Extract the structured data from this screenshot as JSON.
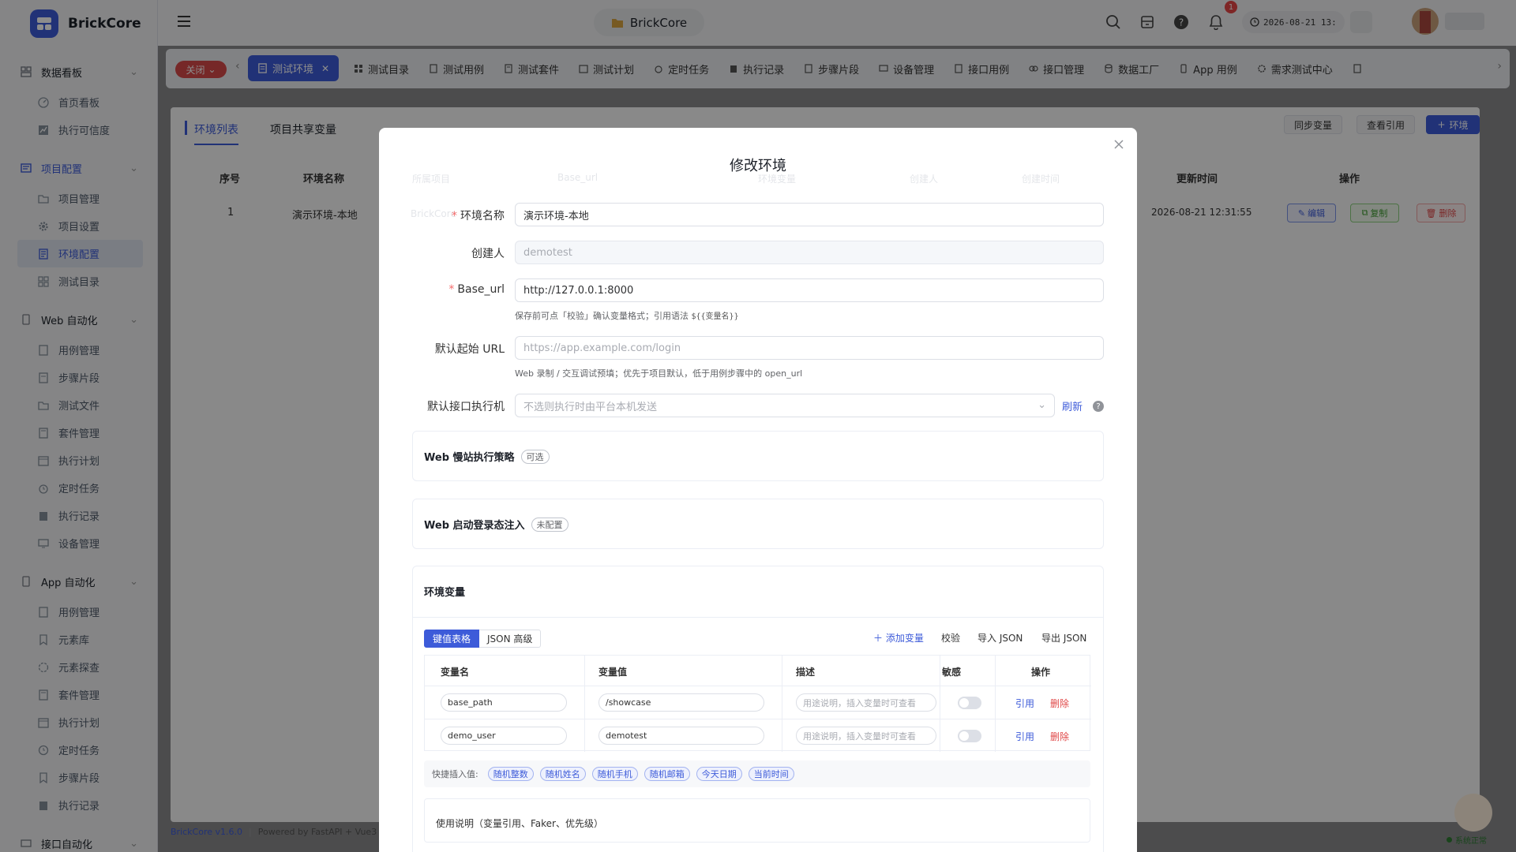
{
  "brand": {
    "name": "BrickCore"
  },
  "sidebar": {
    "groups": [
      {
        "label": "数据看板",
        "items": [
          "首页看板",
          "执行可信度"
        ]
      },
      {
        "label": "项目配置",
        "items": [
          "项目管理",
          "项目设置",
          "环境配置",
          "测试目录"
        ]
      },
      {
        "label": "Web 自动化",
        "items": [
          "用例管理",
          "步骤片段",
          "测试文件",
          "套件管理",
          "执行计划",
          "定时任务",
          "执行记录",
          "设备管理"
        ]
      },
      {
        "label": "App 自动化",
        "items": [
          "用例管理",
          "元素库",
          "元素探查",
          "套件管理",
          "执行计划",
          "定时任务",
          "步骤片段",
          "执行记录"
        ]
      },
      {
        "label": "接口自动化",
        "items": []
      }
    ],
    "active_item": "环境配置"
  },
  "header": {
    "project": "BrickCore",
    "notification_count": "1",
    "datetime": "2026-08-21 13:"
  },
  "tabbar": {
    "close_label": "关闭",
    "active_tab": "测试环境",
    "tabs": [
      "测试目录",
      "测试用例",
      "测试套件",
      "测试计划",
      "定时任务",
      "执行记录",
      "步骤片段",
      "设备管理",
      "接口用例",
      "接口管理",
      "数据工厂",
      "App 用例",
      "需求测试中心"
    ]
  },
  "page": {
    "sub_tabs": [
      "环境列表",
      "项目共享变量"
    ],
    "buttons": {
      "sync": "同步变量",
      "refs": "查看引用",
      "add": "环境"
    },
    "table": {
      "headers": {
        "index": "序号",
        "name": "环境名称",
        "updated": "更新时间",
        "actions": "操作"
      },
      "ghost_headers": [
        "所属项目",
        "Base_url",
        "环境变量",
        "创建人",
        "创建时间"
      ],
      "row": {
        "index": "1",
        "name": "演示环境-本地",
        "updated": "2026-08-21 12:31:55",
        "edit": "编辑",
        "copy": "复制",
        "delete": "删除"
      }
    }
  },
  "footer": {
    "version": "BrickCore v1.6.0",
    "powered": "Powered by FastAPI + Vue3",
    "status": "系统正常"
  },
  "modal": {
    "title": "修改环境",
    "ghost_left": "BrickCore",
    "fields": {
      "name": {
        "label": "环境名称",
        "value": "演示环境-本地"
      },
      "creator": {
        "label": "创建人",
        "value": "demotest"
      },
      "base_url": {
        "label": "Base_url",
        "value": "http://127.0.0.1:8000",
        "hint": "保存前可点「校验」确认变量格式；引用语法",
        "hint_code": "${{变量名}}"
      },
      "start_url": {
        "label": "默认起始 URL",
        "placeholder": "https://app.example.com/login",
        "hint": "Web 录制 / 交互调试预填；优先于项目默认，低于用例步骤中的 open_url"
      },
      "executor": {
        "label": "默认接口执行机",
        "placeholder": "不选则执行时由平台本机发送",
        "refresh": "刷新"
      }
    },
    "cards": {
      "slow_site": {
        "title": "Web 慢站执行策略",
        "tag": "可选"
      },
      "login_inject": {
        "title": "Web 启动登录态注入",
        "tag": "未配置"
      },
      "env_vars": {
        "title": "环境变量"
      }
    },
    "vars": {
      "view_tabs": [
        "键值表格",
        "JSON 高级"
      ],
      "actions": {
        "add": "添加变量",
        "validate": "校验",
        "import": "导入 JSON",
        "export": "导出 JSON"
      },
      "headers": [
        "变量名",
        "变量值",
        "描述",
        "敏感",
        "操作"
      ],
      "desc_placeholder": "用途说明，插入变量时可查看",
      "rows": [
        {
          "name": "base_path",
          "value": "/showcase",
          "ref": "引用",
          "del": "删除"
        },
        {
          "name": "demo_user",
          "value": "demotest",
          "ref": "引用",
          "del": "删除"
        }
      ],
      "quick_label": "快捷插入值:",
      "quick_chips": [
        "随机整数",
        "随机姓名",
        "随机手机",
        "随机邮箱",
        "今天日期",
        "当前时间"
      ],
      "usage": "使用说明（变量引用、Faker、优先级）"
    }
  }
}
